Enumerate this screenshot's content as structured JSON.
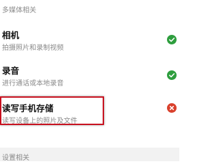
{
  "sections": {
    "media_header": "多媒体相关",
    "settings_header": "设置相关"
  },
  "permissions": [
    {
      "title": "相机",
      "description": "拍摄照片和录制视频",
      "status": "granted",
      "icon": "check-circle-icon",
      "color": "#2e9e3e"
    },
    {
      "title": "录音",
      "description": "进行通话或本地录音",
      "status": "granted",
      "icon": "check-circle-icon",
      "color": "#2e9e3e"
    },
    {
      "title": "读写手机存储",
      "description": "读写设备上的照片及文件",
      "status": "denied",
      "icon": "cross-circle-icon",
      "color": "#d9412d"
    }
  ],
  "highlight_color": "#c8101e"
}
